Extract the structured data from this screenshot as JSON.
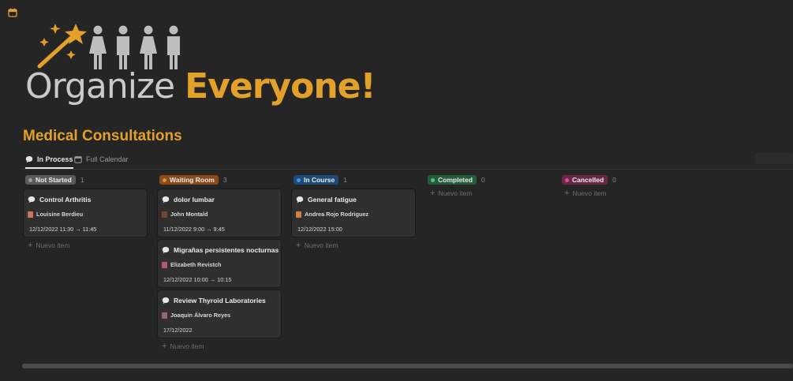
{
  "banner": {
    "word1": "Organize",
    "word2": "Everyone!",
    "accent": "#e3a12a"
  },
  "database": {
    "title": "Medical Consultations"
  },
  "tabs": [
    {
      "label": "In Process",
      "icon": "speech-bubble-icon",
      "active": true
    },
    {
      "label": "Full Calendar",
      "icon": "calendar-icon",
      "active": false
    }
  ],
  "new_item_label": "Nuevo item",
  "columns": [
    {
      "label": "Not Started",
      "count": "1",
      "color": "#5a5a5a",
      "dot": "#9b9b9b",
      "cards": [
        {
          "title": "Control Arthritis",
          "person": "Louisine Berdieu",
          "date": "12/12/2022 11:30 → 11:45"
        }
      ]
    },
    {
      "label": "Waiting Room",
      "count": "3",
      "color": "#8a4a1c",
      "dot": "#e28a2c",
      "cards": [
        {
          "title": "dolor lumbar",
          "person": "John Montald",
          "date": "11/12/2022 9:00 → 9:45"
        },
        {
          "title": "Migrañas persistentes nocturnas",
          "person": "Elizabeth Revistch",
          "date": "12/12/2022 10:00 → 10:15"
        },
        {
          "title": "Review Thyroid Laboratories",
          "person": "Joaquin Álvaro Reyes",
          "date": "17/12/2022"
        }
      ]
    },
    {
      "label": "In Course",
      "count": "1",
      "color": "#1f4a78",
      "dot": "#4a90e2",
      "cards": [
        {
          "title": "General fatigue",
          "person": "Andrea Rojo Rodriguez",
          "date": "12/12/2022 15:00"
        }
      ]
    },
    {
      "label": "Completed",
      "count": "0",
      "color": "#265b3c",
      "dot": "#4fc27a",
      "cards": []
    },
    {
      "label": "Cancelled",
      "count": "0",
      "color": "#6a2848",
      "dot": "#e0508f",
      "cards": []
    }
  ]
}
